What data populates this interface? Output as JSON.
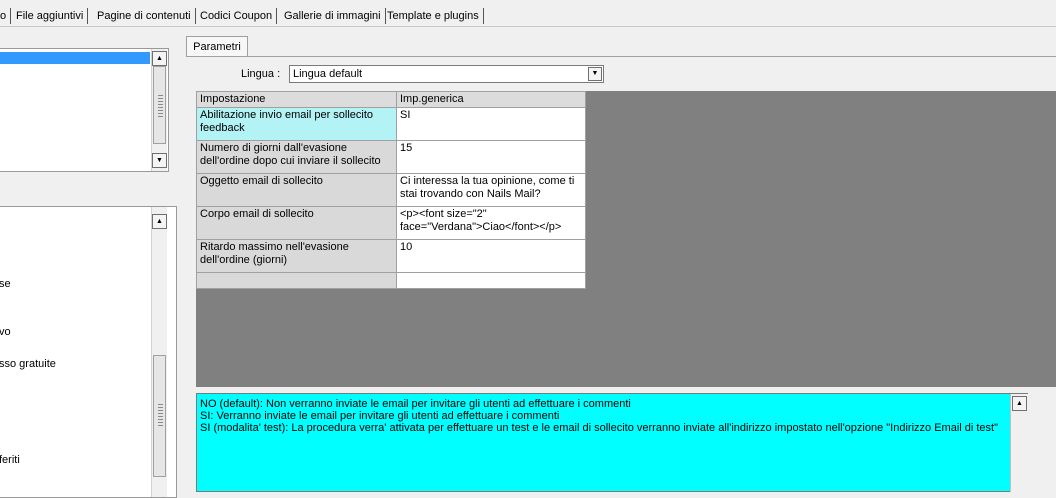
{
  "top_tabs": [
    {
      "label": "o"
    },
    {
      "label": "File aggiuntivi"
    },
    {
      "label": "Pagine di contenuti"
    },
    {
      "label": "Codici Coupon"
    },
    {
      "label": "Gallerie di immagini"
    },
    {
      "label": "Template e plugins"
    }
  ],
  "left_list": {
    "items": [
      {
        "label": "se"
      },
      {
        "label": "vo"
      },
      {
        "label": "sso gratuite"
      },
      {
        "label": "feriti"
      }
    ]
  },
  "params_tab": {
    "label": "Parametri"
  },
  "lingua": {
    "label": "Lingua :",
    "value": "Lingua default"
  },
  "grid": {
    "headers": {
      "setting": "Impostazione",
      "value": "Imp.generica"
    },
    "rows": [
      {
        "setting": "Abilitazione invio email per sollecito feedback",
        "value": "SI"
      },
      {
        "setting": "Numero di giorni dall'evasione dell'ordine dopo cui inviare il sollecito",
        "value": "15"
      },
      {
        "setting": "Oggetto email di sollecito",
        "value": "Ci interessa la tua opinione, come ti stai trovando con Nails Mail?"
      },
      {
        "setting": "Corpo email di sollecito",
        "value": "<p><font size=\"2\" face=\"Verdana\">Ciao</font></p>"
      },
      {
        "setting": "Ritardo massimo nell'evasione dell'ordine (giorni)",
        "value": "10"
      },
      {
        "setting": "",
        "value": ""
      }
    ]
  },
  "description": {
    "lines": [
      "NO (default): Non verranno inviate le email per invitare gli utenti ad effettuare i commenti",
      "SI: Verranno inviate le email per invitare gli utenti ad effettuare i commenti",
      "SI (modalita' test): La procedura verra' attivata per effettuare un test e le email di sollecito verranno inviate all'indirizzo impostato nell'opzione \"Indirizzo Email di test\""
    ]
  },
  "colors": {
    "selected_row": "#b3f2f5",
    "description_bg": "#00ffff",
    "grid_bg": "#808080"
  },
  "icons": {
    "scroll_up": "up-arrow-icon",
    "scroll_down": "down-arrow-icon",
    "dropdown": "chevron-down-icon"
  }
}
